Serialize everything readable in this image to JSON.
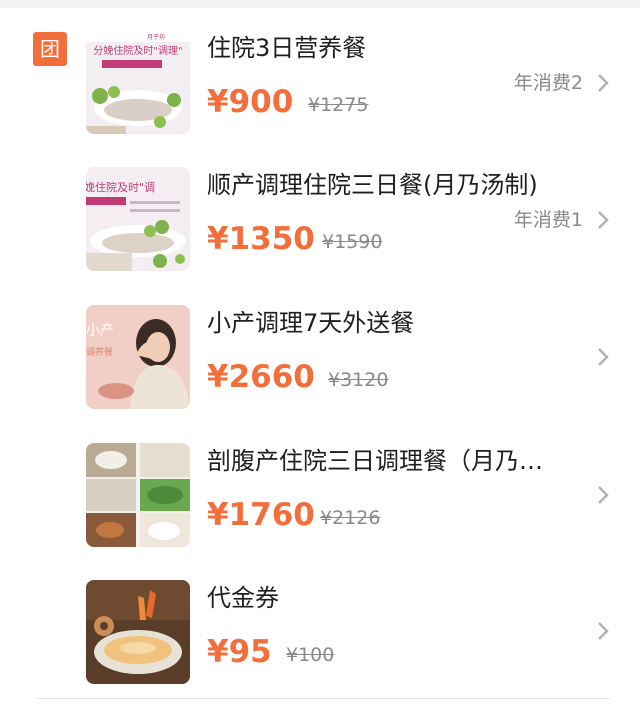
{
  "group_badge": "团",
  "colors": {
    "accent": "#f26e3a",
    "title": "#1f1f1f",
    "muted": "#8a8a8a"
  },
  "deals": [
    {
      "title": "住院3日营养餐",
      "price": "¥900",
      "original_price": "¥1275",
      "annual_sales": "年消费2",
      "thumbnail": {
        "icon": "postpartum-meal-photo",
        "caption": "分娩住院及时\"调理\"",
        "subcaption": "月子坊"
      }
    },
    {
      "title": "顺产调理住院三日餐(月乃汤制)",
      "price": "¥1350",
      "original_price": "¥1590",
      "annual_sales": "年消费1",
      "thumbnail": {
        "icon": "postpartum-meal-photo",
        "caption": "娩住院及时\"调"
      }
    },
    {
      "title": "小产调理7天外送餐",
      "price": "¥2660",
      "original_price": "¥3120",
      "annual_sales": "",
      "thumbnail": {
        "icon": "woman-portrait-photo",
        "caption": "小产",
        "subcaption": "调养餐"
      }
    },
    {
      "title": "剖腹产住院三日调理餐（月乃…",
      "price": "¥1760",
      "original_price": "¥2126",
      "annual_sales": "",
      "thumbnail": {
        "icon": "meal-grid-photo"
      }
    },
    {
      "title": "代金券",
      "price": "¥95",
      "original_price": "¥100",
      "annual_sales": "",
      "thumbnail": {
        "icon": "soup-dish-photo"
      }
    }
  ]
}
